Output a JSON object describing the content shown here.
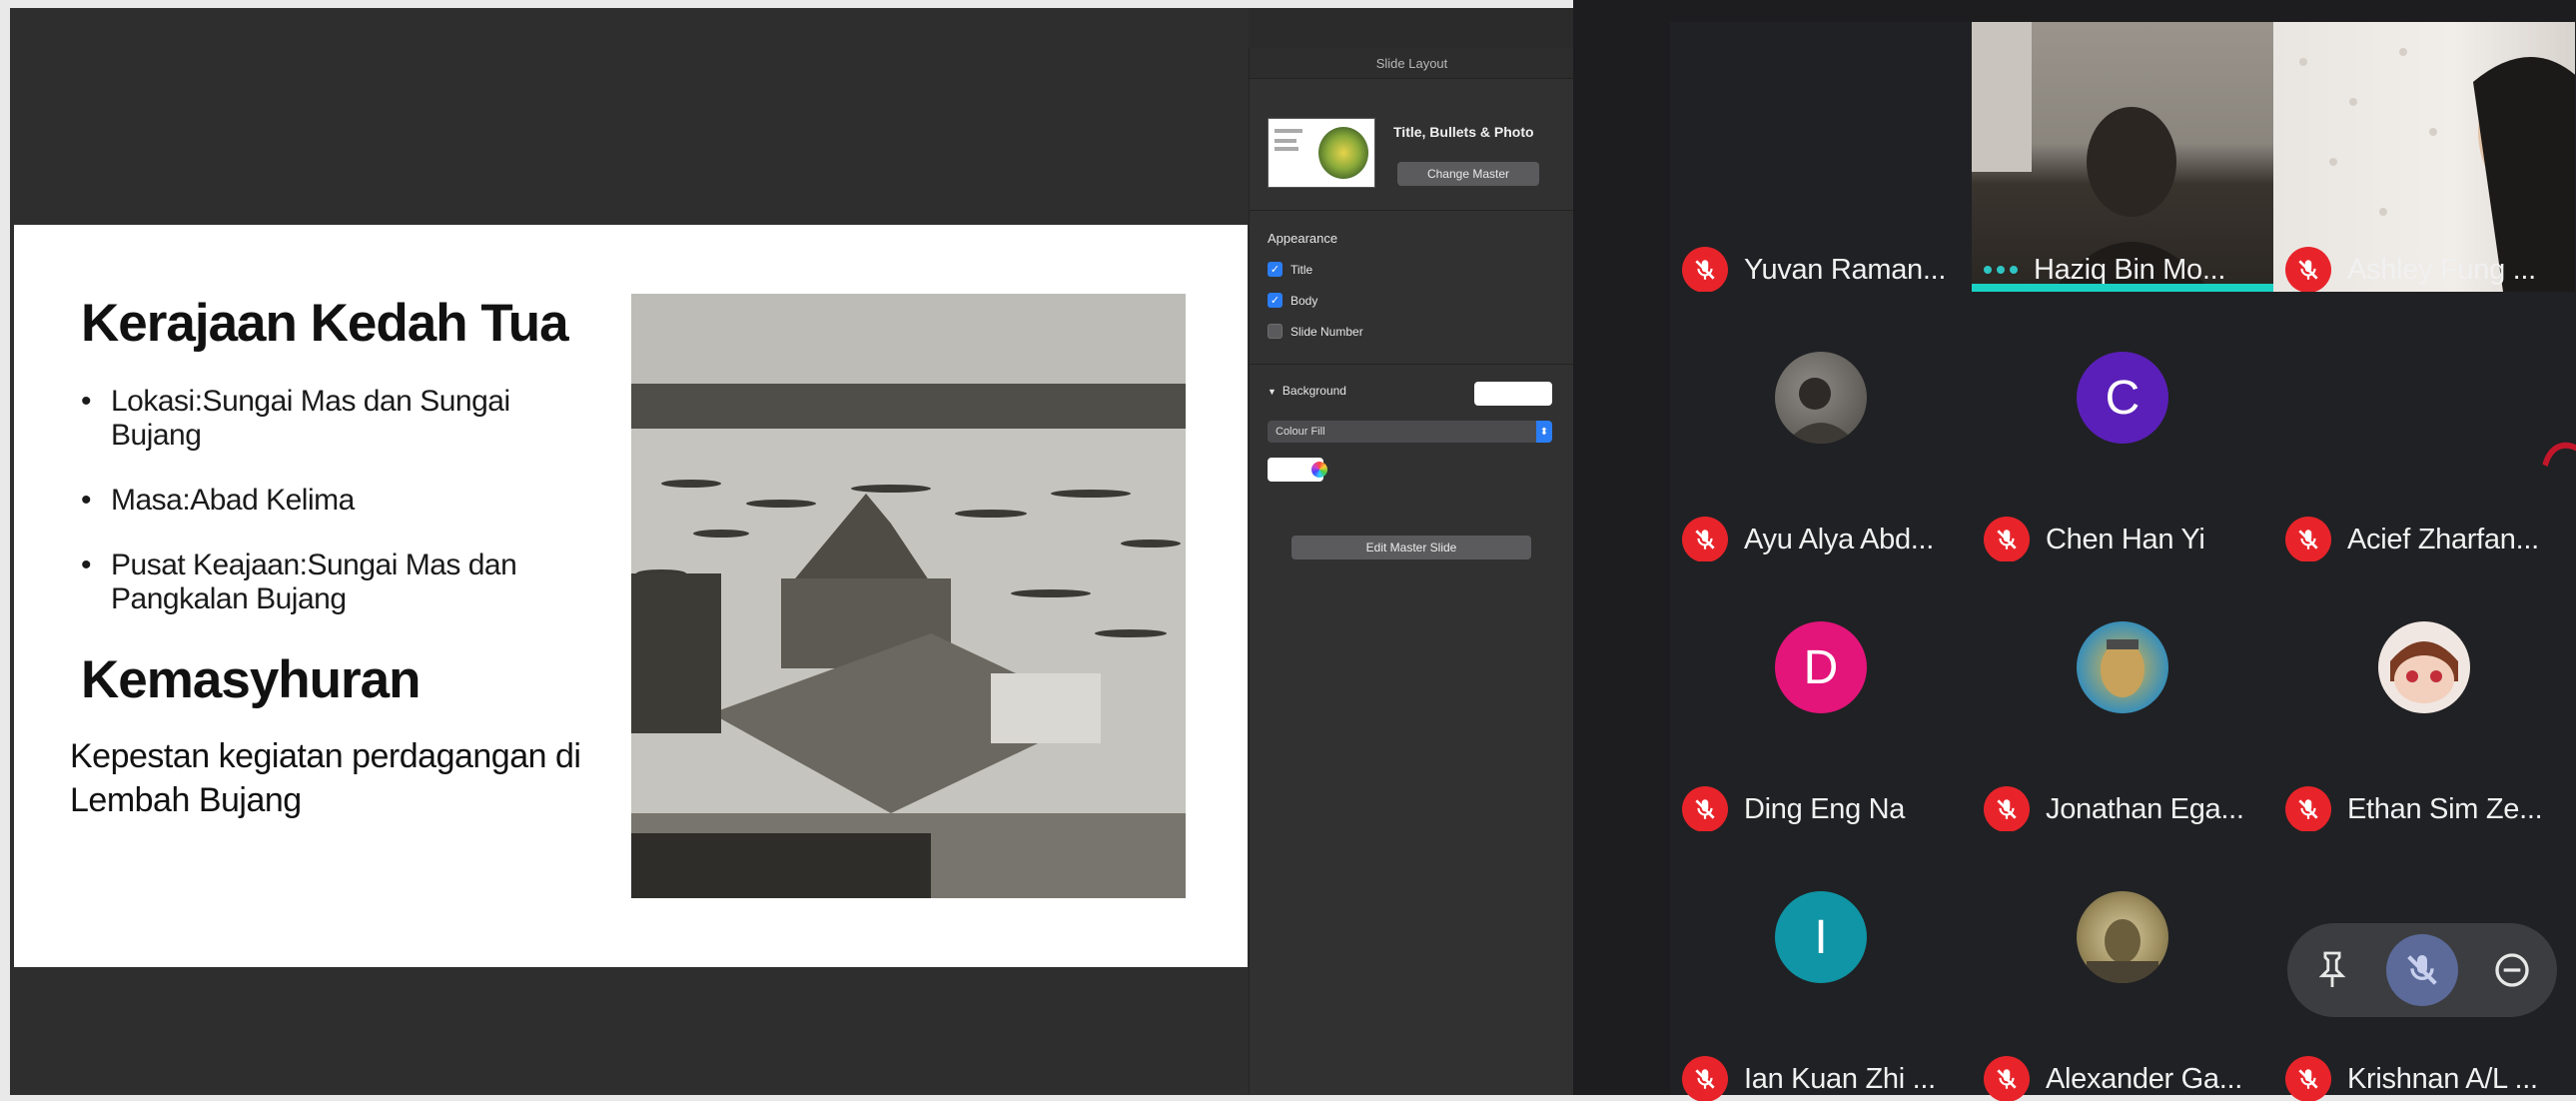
{
  "slide": {
    "title1": "Kerajaan Kedah Tua",
    "bullets": [
      "Lokasi:Sungai Mas dan Sungai Bujang",
      "Masa:Abad Kelima",
      "Pusat Keajaan:Sungai Mas dan Pangkalan Bujang"
    ],
    "title2": "Kemasyhuran",
    "body": "Kepestan kegiatan perdagangan di Lembah Bujang",
    "photo_icon": "historical-river-palace-photo"
  },
  "inspector": {
    "header": "Slide Layout",
    "layout_name": "Title, Bullets & Photo",
    "change_master": "Change Master",
    "appearance_title": "Appearance",
    "checkboxes": [
      {
        "label": "Title",
        "checked": true
      },
      {
        "label": "Body",
        "checked": true
      },
      {
        "label": "Slide Number",
        "checked": false
      }
    ],
    "background_label": "Background",
    "fill_type": "Colour Fill",
    "edit_master": "Edit Master Slide",
    "accent_color": "#2a7df4"
  },
  "participants": [
    {
      "name": "Yuvan Raman...",
      "muted": true,
      "avatar": "none"
    },
    {
      "name": "Haziq Bin Mo...",
      "muted": false,
      "speaking": true,
      "avatar": "video"
    },
    {
      "name": "Ashley Fung ...",
      "muted": true,
      "avatar": "video"
    },
    {
      "name": "Ayu Alya Abd...",
      "muted": true,
      "avatar": "photo"
    },
    {
      "name": "Chen Han Yi",
      "muted": true,
      "avatar": "letter",
      "letter": "C",
      "color": "#5a1fb8"
    },
    {
      "name": "Acief Zharfan...",
      "muted": true,
      "avatar": "none"
    },
    {
      "name": "Ding Eng Na",
      "muted": true,
      "avatar": "letter",
      "letter": "D",
      "color": "#e3147a"
    },
    {
      "name": "Jonathan Ega...",
      "muted": true,
      "avatar": "photo"
    },
    {
      "name": "Ethan Sim Ze...",
      "muted": true,
      "avatar": "photo"
    },
    {
      "name": "Ian Kuan Zhi ...",
      "muted": true,
      "avatar": "letter",
      "letter": "I",
      "color": "#0f95a5"
    },
    {
      "name": "Alexander Ga...",
      "muted": true,
      "avatar": "photo"
    },
    {
      "name": "Krishnan A/L ...",
      "muted": true,
      "avatar": "none"
    }
  ],
  "controls": {
    "icons": [
      "pin-icon",
      "mute-icon",
      "remove-icon"
    ]
  },
  "colors": {
    "mute_badge": "#e8242a",
    "active_speaker": "#1ad1c4",
    "meeting_bg": "#202124"
  }
}
